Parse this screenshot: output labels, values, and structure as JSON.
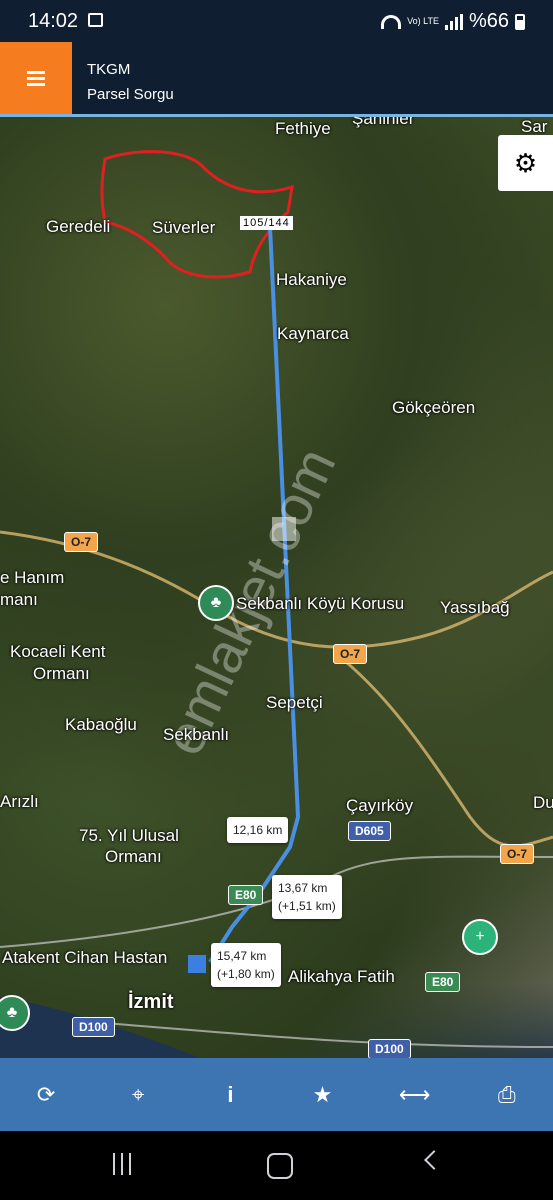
{
  "status_bar": {
    "time": "14:02",
    "battery": "%66",
    "volte": "Vo) LTE"
  },
  "app_bar": {
    "title_line1": "TKGM",
    "title_line2": "Parsel Sorgu"
  },
  "map": {
    "places": [
      "Fethiye",
      "Şahinler",
      "Sar",
      "Geredeli",
      "Süverler",
      "Hakaniye",
      "Kaynarca",
      "Gökçeören",
      "e Hanım",
      "manı",
      "Sekbanlı Köyü Korusu",
      "Yassıbağ",
      "Kocaeli Kent",
      "Ormanı",
      "Kabaoğlu",
      "Sekbanlı",
      "Sepetçi",
      "Arızlı",
      "75. Yıl Ulusal",
      "Ormanı",
      "Çayırköy",
      "Du",
      "Atakent Cihan Hastan",
      "İzmit",
      "Alikahya Fatih"
    ],
    "roads": [
      "O-7",
      "O-7",
      "O-7",
      "D605",
      "E80",
      "E80",
      "D100",
      "D100"
    ],
    "parcel_label": "105/144",
    "distances": [
      {
        "line1": "12,16 km",
        "line2": ""
      },
      {
        "line1": "13,67 km",
        "line2": "(+1,51 km)"
      },
      {
        "line1": "15,47 km",
        "line2": "(+1,80 km)"
      }
    ],
    "watermark": "emlakjet.com"
  },
  "toolbar": [
    "refresh-icon",
    "locate-icon",
    "info-icon",
    "star-icon",
    "measure-icon",
    "print-icon"
  ],
  "colors": {
    "app_bar": "#0f1e30",
    "menu_button": "#f57d20",
    "toolbar": "#3d74b2",
    "route": "#4a90e2",
    "parcel": "#e02020"
  }
}
